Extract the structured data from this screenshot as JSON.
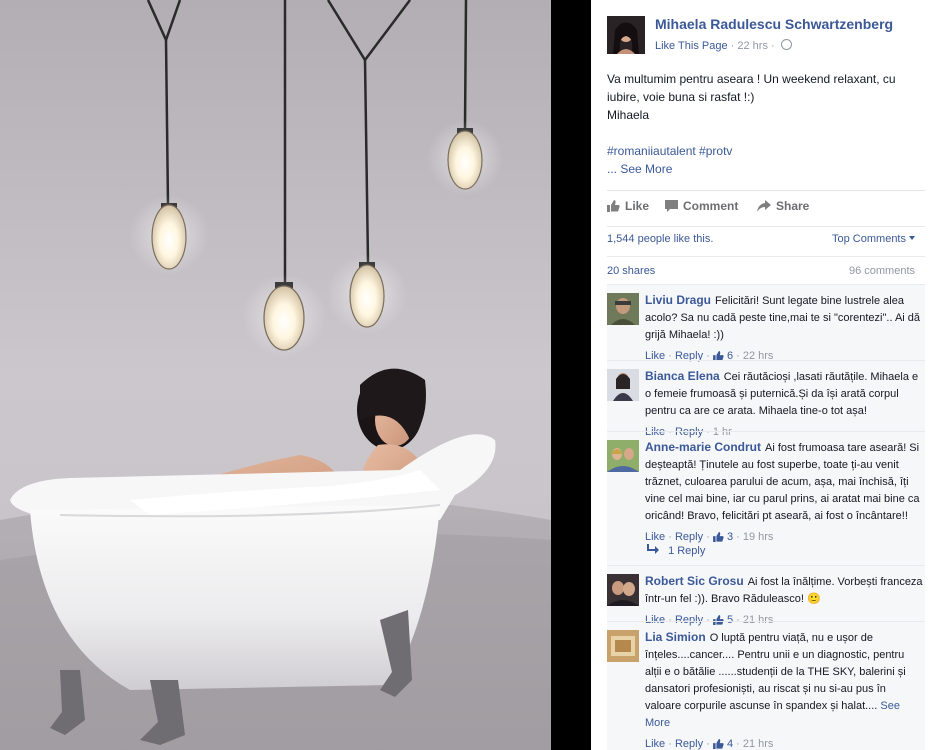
{
  "post": {
    "page_name": "Mihaela Radulescu Schwartzenberg",
    "like_page": "Like This Page",
    "time": "22 hrs",
    "line1": "Va multumim pentru aseara ! Un weekend relaxant, cu iubire, voie buna si rasfat !:)",
    "line2": "Mihaela",
    "hashtags": "#romaniiautalent #protv",
    "see_more": "... See More"
  },
  "actions": {
    "like": "Like",
    "comment": "Comment",
    "share": "Share"
  },
  "stats": {
    "likes": "1,544 people like this.",
    "top_comments": "Top Comments",
    "shares": "20 shares",
    "comments": "96 comments"
  },
  "comments": [
    {
      "author": "Liviu Dragu",
      "text": "Felicitări! Sunt legate bine lustrele alea acolo? Sa nu cadă peste tine,mai te si \"corentezi\".. Ai dă grijă Mihaela! :))",
      "like": "Like",
      "reply": "Reply",
      "likes": "6",
      "time": "22 hrs"
    },
    {
      "author": "Bianca Elena",
      "text": "Cei răutăcioși ,lasati răutățile. Mihaela e o femeie frumoasă și puternică.Și da își arată corpul pentru ca are ce arata. Mihaela tine-o tot așa!",
      "like": "Like",
      "reply": "Reply",
      "likes": "",
      "time": "1 hr"
    },
    {
      "author": "Anne-marie Condrut",
      "text": "Ai fost frumoasa tare aseară! Si deșteaptă! Ținutele au fost superbe, toate ți-au venit trăznet, culoarea parului de acum, așa, mai închisă, îți vine cel mai bine, iar cu parul prins, ai aratat mai bine ca oricând! Bravo, felicitări pt aseară, ai fost o încântare!!",
      "like": "Like",
      "reply": "Reply",
      "likes": "3",
      "time": "19 hrs",
      "replies": "1 Reply"
    },
    {
      "author": "Robert Sic Grosu",
      "text": "Ai fost la înălțime. Vorbești franceza într-un fel :)). Bravo Răduleasco! 🙂",
      "like": "Like",
      "reply": "Reply",
      "likes": "5",
      "time": "21 hrs"
    },
    {
      "author": "Lia Simion",
      "text": "O luptă pentru viață, nu e ușor de înțeles....cancer.... Pentru unii e un diagnostic, pentru alții e o bătălie ......studenții de la THE SKY, balerini și dansatori profesioniști, au riscat și nu si-au pus în valoare corpurile ascunse în spandex și halat....",
      "see_more": "See More",
      "like": "Like",
      "reply": "Reply",
      "likes": "4",
      "time": "21 hrs"
    }
  ],
  "colors": {
    "link": "#3b5998",
    "meta": "#9197a3",
    "text": "#141823",
    "comments_bg": "#f6f7f9"
  }
}
